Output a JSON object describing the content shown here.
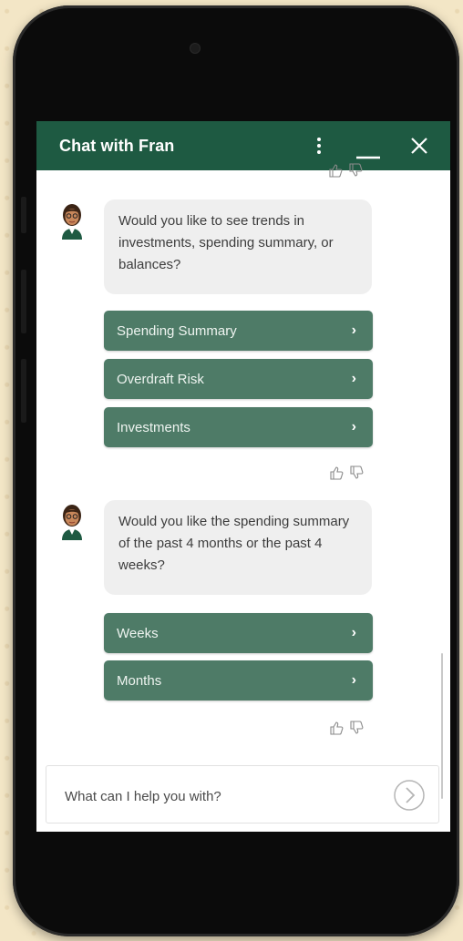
{
  "chat": {
    "title": "Chat with Fran",
    "menu_icon": "vertical-dots-icon",
    "minimize_icon": "minimize-icon",
    "close_icon": "close-icon"
  },
  "messages": [
    {
      "text": "Would you like to see trends in investments, spending summary, or balances?",
      "options": [
        "Spending Summary",
        "Overdraft Risk",
        "Investments"
      ]
    },
    {
      "text": "Would you like the spending summary of the past 4 months or the past 4 weeks?",
      "options": [
        "Weeks",
        "Months"
      ]
    }
  ],
  "input": {
    "placeholder": "What can I help you with?",
    "send_icon": "send-arrow-icon"
  },
  "colors": {
    "header": "#1e5a42",
    "option_button": "#4e7b67",
    "bubble": "#efefef",
    "background": "#f3e6c6"
  }
}
